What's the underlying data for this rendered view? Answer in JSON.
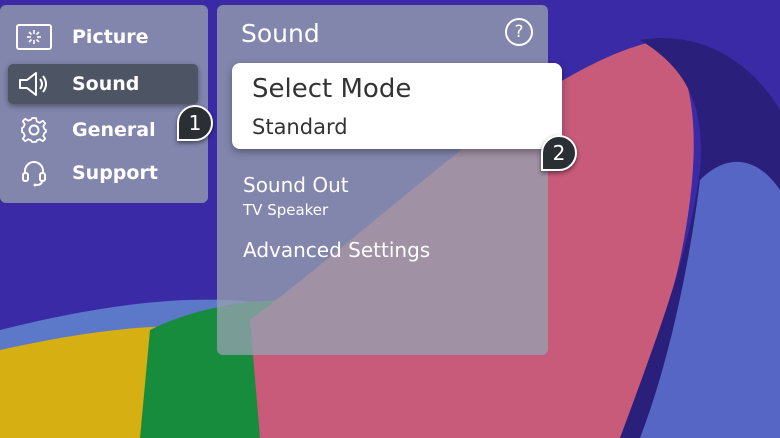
{
  "menu": {
    "items": [
      {
        "label": "Picture",
        "icon": "picture-icon"
      },
      {
        "label": "Sound",
        "icon": "speaker-icon",
        "selected": true
      },
      {
        "label": "General",
        "icon": "gear-icon"
      },
      {
        "label": "Support",
        "icon": "headset-icon"
      }
    ]
  },
  "sound_panel": {
    "title": "Sound",
    "help_symbol": "?",
    "select_mode": {
      "label": "Select Mode",
      "value": "Standard"
    },
    "sound_out": {
      "label": "Sound Out",
      "value": "TV Speaker"
    },
    "advanced": {
      "label": "Advanced Settings"
    }
  },
  "markers": {
    "first": "1",
    "second": "2"
  },
  "colors": {
    "background": "#3c2aa6",
    "panel": "#96a0af",
    "selected_item": "#4d5564",
    "card": "#ffffff"
  }
}
